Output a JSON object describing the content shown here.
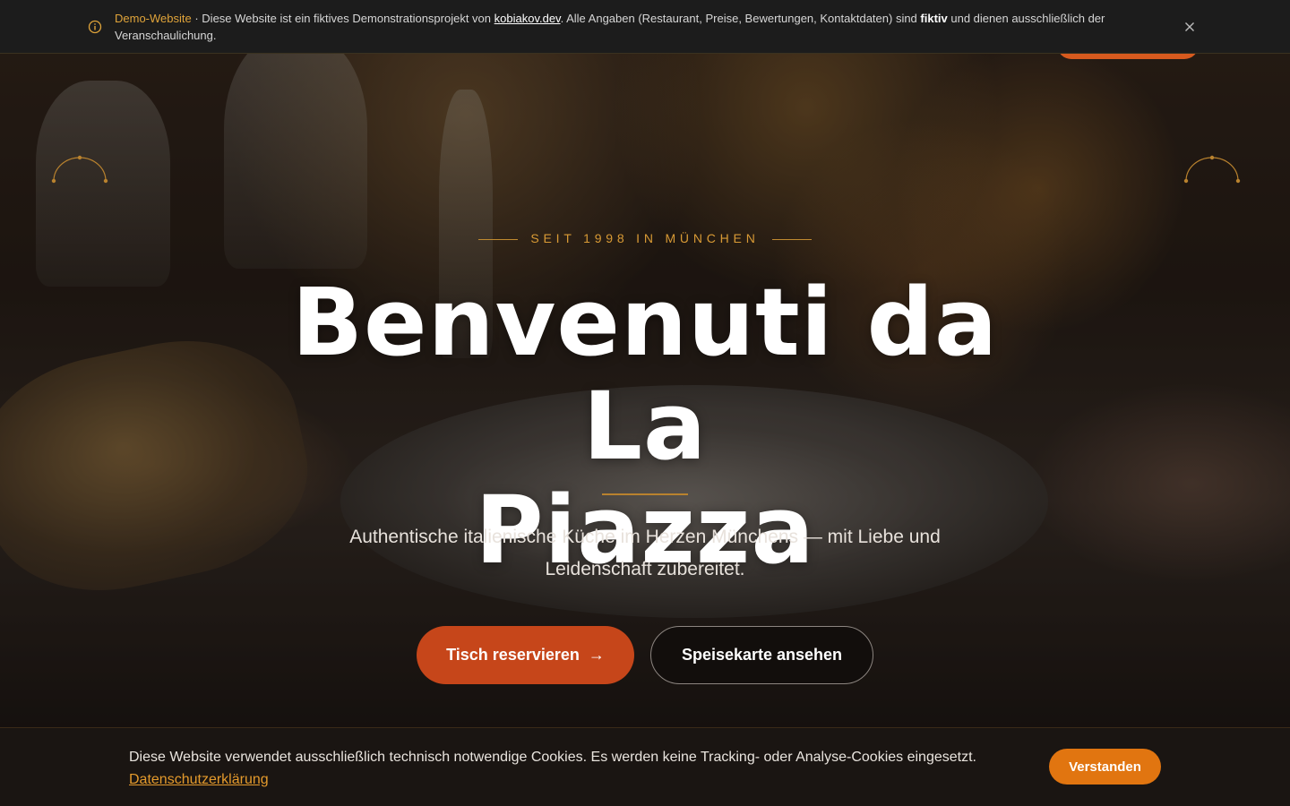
{
  "demo_banner": {
    "brand": "Demo-Website",
    "text_before_link": " · Diese Website ist ein fiktives Demonstrationsprojekt von ",
    "link": "kobiakov.dev",
    "text_after_link": ". Alle Angaben (Restaurant, Preise, Bewertungen, Kontaktdaten) sind ",
    "bold": "fiktiv",
    "text_end": " und dienen ausschließlich der Veranschaulichung.",
    "icon": "info-icon",
    "close_icon": "close-icon"
  },
  "hero": {
    "eyebrow": "SEIT 1998 IN MÜNCHEN",
    "title_line1": "Benvenuti da La",
    "title_line2": "Piazza",
    "subtitle": "Authentische italienische Küche im Herzen Münchens — mit Liebe und Leidenschaft zubereitet.",
    "primary_button": "Tisch reservieren",
    "primary_arrow": "→",
    "secondary_button": "Speisekarte ansehen"
  },
  "cookie": {
    "text": "Diese Website verwendet ausschließlich technisch notwendige Cookies. Es werden keine Tracking- oder Analyse-Cookies eingesetzt.",
    "link": "Datenschutzerklärung",
    "button": "Verstanden"
  },
  "colors": {
    "accent_orange": "#c6461a",
    "gold": "#d89a35",
    "cookie_button": "#e17510"
  }
}
